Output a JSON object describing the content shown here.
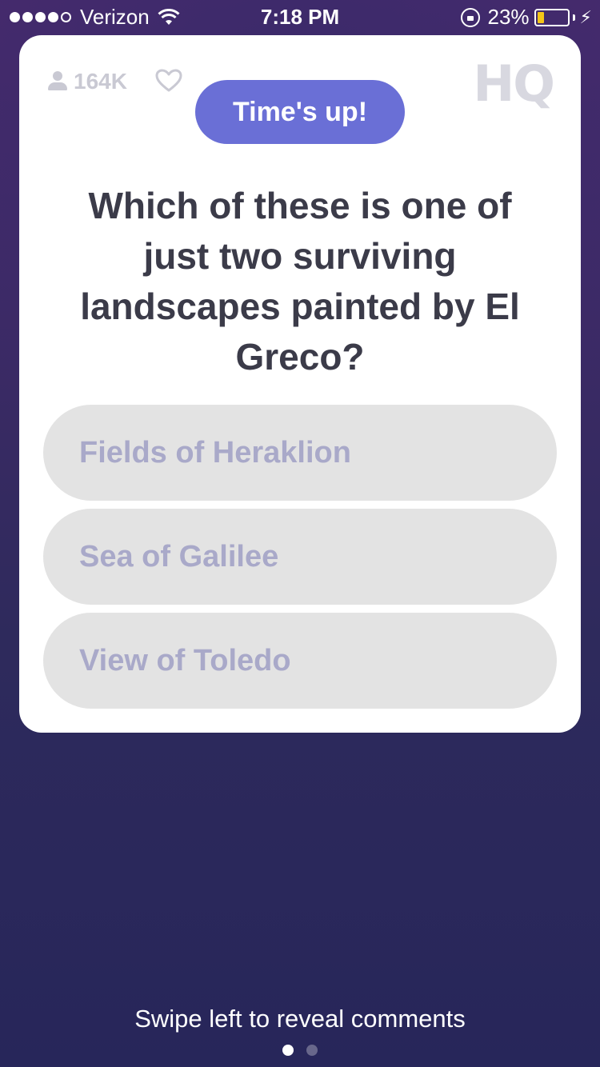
{
  "status_bar": {
    "carrier": "Verizon",
    "signal_bars_filled": 4,
    "signal_bars_total": 5,
    "time": "7:18 PM",
    "battery_percent_label": "23%",
    "battery_level": 0.23,
    "battery_fill_color": "#f5c518"
  },
  "header": {
    "viewer_count": "164K",
    "logo": "HQ"
  },
  "timer": {
    "label": "Time's up!",
    "color": "#6a6fd6"
  },
  "question": {
    "text": "Which of these is one of just two surviving landscapes painted by El Greco?"
  },
  "answers": [
    {
      "label": "Fields of Heraklion"
    },
    {
      "label": "Sea of Galilee"
    },
    {
      "label": "View of Toledo"
    }
  ],
  "footer": {
    "hint": "Swipe left to reveal comments",
    "page_count": 2,
    "active_page": 1
  }
}
